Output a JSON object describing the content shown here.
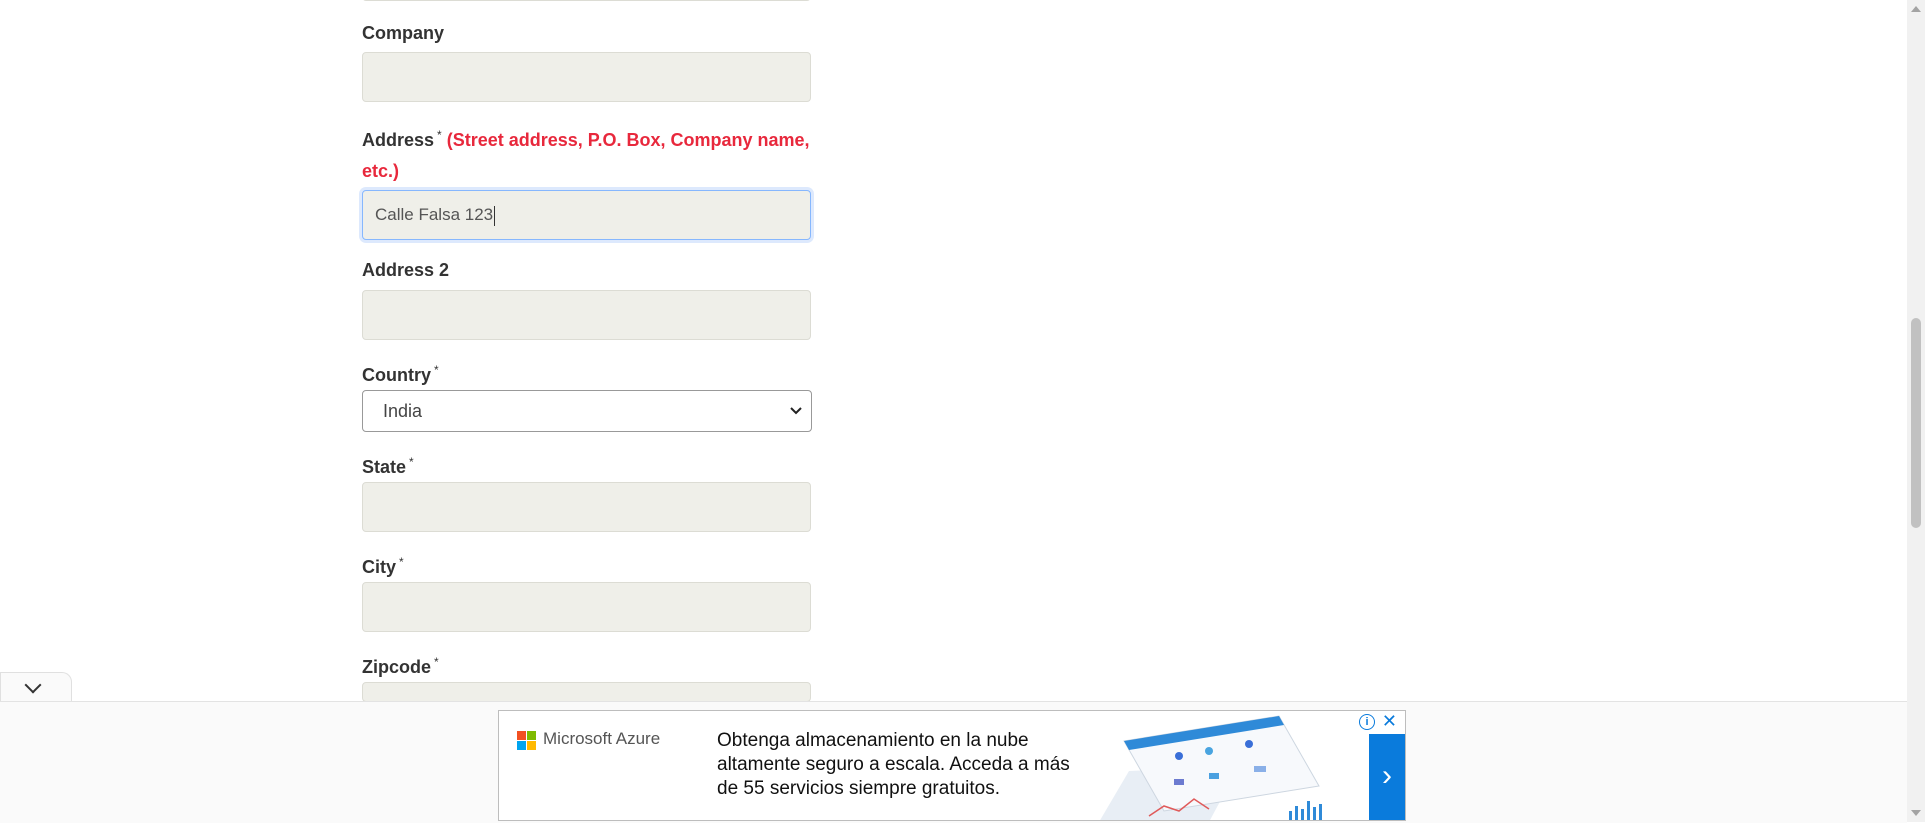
{
  "form": {
    "company": {
      "label": "Company",
      "value": ""
    },
    "address": {
      "label": "Address",
      "required_mark": "*",
      "hint": "(Street address, P.O. Box, Company name, etc.)",
      "value": "Calle Falsa 123"
    },
    "address2": {
      "label": "Address 2",
      "value": ""
    },
    "country": {
      "label": "Country",
      "required_mark": "*",
      "selected": "India"
    },
    "state": {
      "label": "State",
      "required_mark": "*",
      "value": ""
    },
    "city": {
      "label": "City",
      "required_mark": "*",
      "value": ""
    },
    "zipcode": {
      "label": "Zipcode",
      "required_mark": "*",
      "value": ""
    }
  },
  "ad": {
    "brand": "Microsoft Azure",
    "text": "Obtenga almacenamiento en la nube altamente seguro a escala. Acceda a más de 55 servicios siempre gratuitos.",
    "cta_glyph": "›",
    "info_glyph": "i",
    "close_glyph": "✕",
    "colors": {
      "cta": "#0a7bdc"
    }
  },
  "colors": {
    "hint_red": "#e8283c",
    "field_bg": "#efefe9",
    "focus_border": "#86b7fe"
  }
}
